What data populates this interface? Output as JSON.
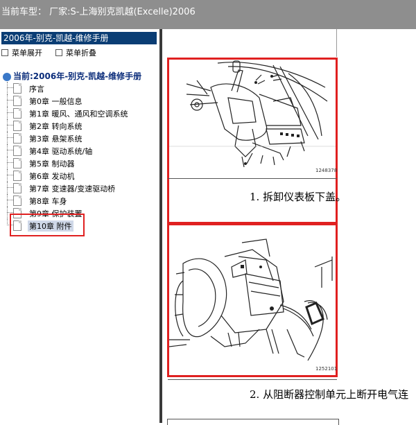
{
  "window": {
    "title": "当前车型： 厂家:S-上海别克凯越(Excelle)2006"
  },
  "sidebar": {
    "manual_title": "2006年-别克-凯越-维修手册",
    "expand_label": "菜单展开",
    "collapse_label": "菜单折叠",
    "current_label": "当前:2006年-别克-凯越-维修手册",
    "items": [
      {
        "label": "序言"
      },
      {
        "label": "第0章 一般信息"
      },
      {
        "label": "第1章 暖风、通风和空调系统"
      },
      {
        "label": "第2章 转向系统"
      },
      {
        "label": "第3章 悬架系统"
      },
      {
        "label": "第4章 驱动系统/轴"
      },
      {
        "label": "第5章 制动器"
      },
      {
        "label": "第6章 发动机"
      },
      {
        "label": "第7章 变速器/变速驱动桥"
      },
      {
        "label": "第8章 车身"
      },
      {
        "label": "第9章 保护装置"
      },
      {
        "label": "第10章 附件"
      }
    ]
  },
  "content": {
    "figure1_number": "1248378",
    "step1_text": "1. 拆卸仪表板下盖。",
    "figure2_number": "1252101",
    "step2_text": "2. 从阻断器控制单元上断开电气连"
  }
}
